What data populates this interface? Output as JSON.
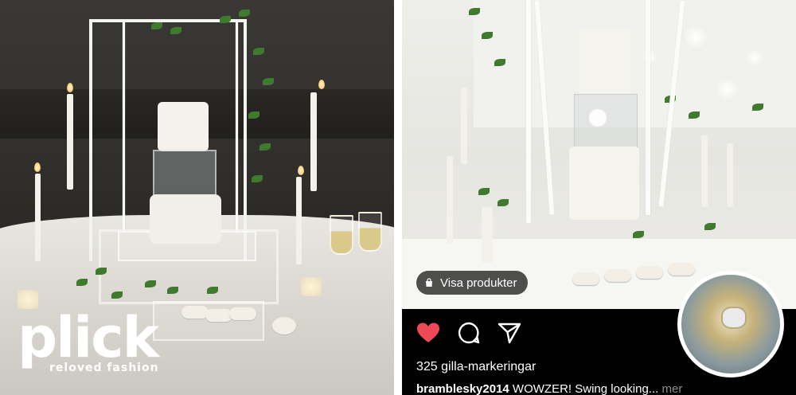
{
  "logo": {
    "word": "plick",
    "tagline": "reloved fashion"
  },
  "post": {
    "shop_button": "Visa produkter",
    "likes": "325 gilla-markeringar",
    "caption_user": "bramblesky2014",
    "caption_text": "WOWZER! Swing looking...",
    "more": "mer"
  },
  "icons": {
    "like": "heart-icon",
    "comment": "comment-icon",
    "share": "send-icon",
    "shop": "shopping-bag-icon"
  },
  "colors": {
    "like_heart": "#ed4956",
    "post_background": "#000000",
    "caption_more": "#8e8e8e"
  }
}
